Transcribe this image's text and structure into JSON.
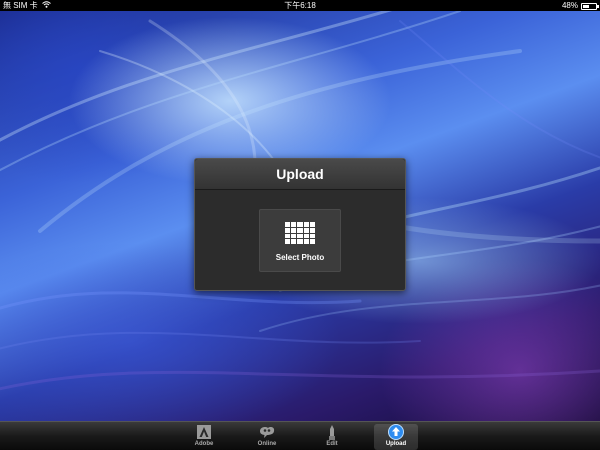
{
  "status_bar": {
    "carrier": "無 SIM 卡",
    "wifi_icon": "wifi-icon",
    "time": "下午6:18",
    "battery_percent": "48%",
    "battery_level": 0.48
  },
  "panel": {
    "title": "Upload",
    "select_photo_label": "Select Photo",
    "icon": "photo-grid-icon"
  },
  "tab_bar": {
    "tabs": [
      {
        "label": "Adobe",
        "icon": "adobe-logo-icon"
      },
      {
        "label": "Online",
        "icon": "online-icon"
      },
      {
        "label": "Edit",
        "icon": "edit-pencil-icon"
      },
      {
        "label": "Upload",
        "icon": "upload-arrow-icon",
        "active": true
      }
    ]
  },
  "colors": {
    "active_tab_accent": "#2e8cf0",
    "panel_background": "#2c2c2c"
  }
}
